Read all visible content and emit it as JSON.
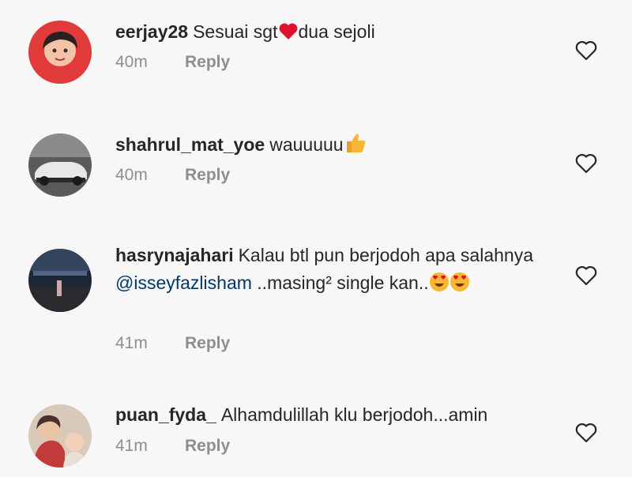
{
  "comments": [
    {
      "username": "eerjay28",
      "text_before": "Sesuai sgt",
      "emoji": "heart",
      "text_after": "dua sejoli",
      "time": "40m",
      "reply_label": "Reply"
    },
    {
      "username": "shahrul_mat_yoe",
      "text_before": "wauuuuu",
      "emoji": "thumbs-up",
      "time": "40m",
      "reply_label": "Reply"
    },
    {
      "username": "hasrynajahari",
      "text_before": "Kalau btl pun berjodoh apa salahnya",
      "mention": "@isseyfazlisham",
      "text_after": "..masing² single kan..",
      "emoji": "heart-eyes",
      "emoji_count": 2,
      "time": "41m",
      "reply_label": "Reply"
    },
    {
      "username": "puan_fyda_",
      "text_before": "Alhamdulillah klu berjodoh...amin",
      "time": "41m",
      "reply_label": "Reply"
    }
  ],
  "icons": {
    "like": "heart-outline-icon"
  },
  "colors": {
    "text": "#262626",
    "secondary": "#8e8e8e",
    "mention": "#00376b",
    "heart": "#e0112b",
    "background": "#f7f7f7"
  }
}
